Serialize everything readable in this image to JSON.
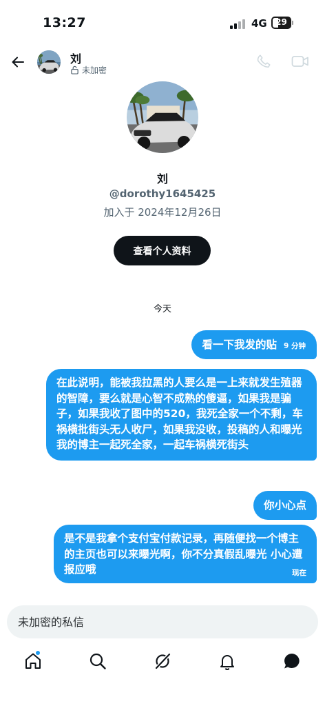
{
  "status": {
    "time": "13:27",
    "network": "4G",
    "battery": "29"
  },
  "header": {
    "name": "刘",
    "encryption": "未加密"
  },
  "profile": {
    "name": "刘",
    "handle": "@dorothy1645425",
    "joined": "加入于 2024年12月26日",
    "view_profile_label": "查看个人资料"
  },
  "day_separator": "今天",
  "messages": [
    {
      "text": "看一下我发的贴",
      "time": "9 分钟"
    },
    {
      "text": "在此说明，能被我拉黑的人要么是一上来就发生殖器的智障，要么就是心智不成熟的傻逼，如果我是骗子，如果我收了图中的520，我死全家一个不剩，车祸横批街头无人收尸，如果我没收，投稿的人和曝光我的博主一起死全家，一起车祸横死街头"
    },
    {
      "text": "你小心点"
    },
    {
      "text": "是不是我拿个支付宝付款记录，再随便找一个博主的主页也可以来曝光啊，你不分真假乱曝光 小心遭报应哦",
      "time": "现在"
    }
  ],
  "compose": {
    "placeholder": "未加密的私信"
  },
  "nav": [
    "home-icon",
    "search-icon",
    "grok-icon",
    "bell-icon",
    "messages-icon"
  ],
  "colors": {
    "accent": "#1d9bf0",
    "text": "#0f1419",
    "muted": "#536471",
    "input_bg": "#eff3f4"
  }
}
